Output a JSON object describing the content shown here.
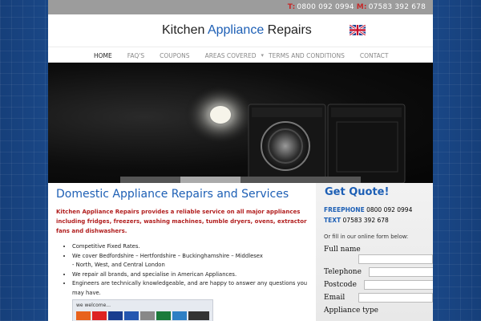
{
  "topbar": {
    "t_label": "T:",
    "t_number": "0800 092 0994",
    "m_label": "M:",
    "m_number": "07583 392 678"
  },
  "logo": {
    "word1": "Kitchen ",
    "word2": "Appliance",
    "word3": " Repairs"
  },
  "nav": {
    "items": [
      {
        "label": "HOME"
      },
      {
        "label": "FAQ'S"
      },
      {
        "label": "COUPONS"
      },
      {
        "label": "AREAS COVERED"
      },
      {
        "label": "TERMS AND CONDITIONS"
      },
      {
        "label": "CONTACT"
      }
    ],
    "dropdown_glyph": "▾"
  },
  "main": {
    "title": "Domestic Appliance Repairs and Services",
    "intro": "Kitchen Appliance Repairs provides a reliable service on all major appliances including fridges, freezers, washing machines, tumble dryers, ovens, extractor fans and dishwashers.",
    "features": [
      {
        "text": "Competitive Fixed Rates."
      },
      {
        "text": "We cover Bedfordshire – Hertfordshire – Buckinghamshire – Middlesex",
        "sub": "- North, West, and Central London"
      },
      {
        "text": "We repair all brands, and specialise in American Appliances."
      },
      {
        "text": "Engineers are technically knowledgeable, and are happy to answer any questions you may have."
      }
    ],
    "cards_welcome": "we welcome..."
  },
  "sidebar": {
    "title": "Get Quote!",
    "freephone_label": "FREEPHONE",
    "freephone_number": "0800 092 0994",
    "text_label": "TEXT",
    "text_number": "07583 392 678",
    "fill_text": "Or fill in our online form below:",
    "fields": [
      {
        "label": "Full name"
      },
      {
        "label": "Telephone"
      },
      {
        "label": "Postcode"
      },
      {
        "label": "Email"
      },
      {
        "label": "Appliance type"
      }
    ]
  },
  "colors": {
    "accent_blue": "#1d5fb5",
    "accent_red": "#b11e1e",
    "topbar_gray": "#9c9c9c",
    "background_blue": "#1a4f95"
  }
}
